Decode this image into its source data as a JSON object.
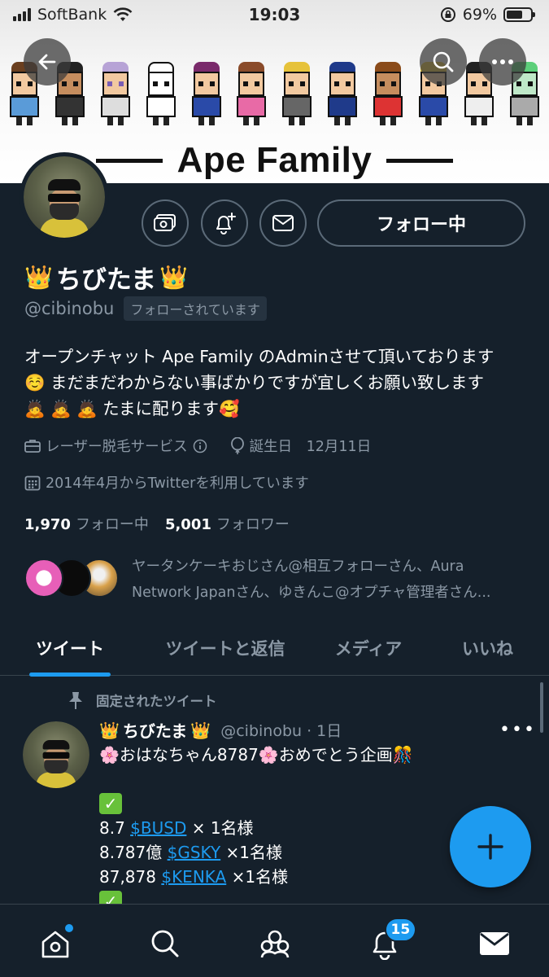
{
  "status_bar": {
    "carrier": "SoftBank",
    "time": "19:03",
    "battery": "69%",
    "battery_level": 0.69
  },
  "banner": {
    "title": "Ape Family"
  },
  "profile": {
    "crown_emoji": "👑",
    "display_name": "ちびたま",
    "handle": "@cibinobu",
    "follows_you": "フォローされています",
    "follow_button": "フォロー中",
    "bio_lines": [
      "オープンチャット Ape Family のAdminさせて頂いております",
      "☺️ まだまだわからない事ばかりですが宜しくお願い致します",
      "🙇 🙇 🙇 たまに配ります🥰"
    ],
    "category": "レーザー脱毛サービス",
    "birthday": "誕生日　12月11日",
    "joined": "2014年4月からTwitterを利用しています",
    "following_count": "1,970",
    "following_label": "フォロー中",
    "followers_count": "5,001",
    "followers_label": "フォロワー",
    "followed_by_lines": [
      "ヤータンケーキおじさん@相互フォローさん、Aura",
      "Network Japanさん、ゆきんこ@オプチャ管理者さん..."
    ]
  },
  "tabs": [
    "ツイート",
    "ツイートと返信",
    "メディア",
    "いいね"
  ],
  "pinned_tweet": {
    "pinned_label": "固定されたツイート",
    "author": "ちびたま",
    "handle_time": "@cibinobu · 1日",
    "line1": "🌸おはなちゃん8787🌸おめでとう企画🎊",
    "check": "✓",
    "giveaways": [
      {
        "prefix": "8.7 ",
        "tag": "$BUSD",
        "suffix": " × 1名様"
      },
      {
        "prefix": "8.787億 ",
        "tag": "$GSKY",
        "suffix": " ×1名様"
      },
      {
        "prefix": "87,878 ",
        "tag": "$KENKA",
        "suffix": " ×1名様"
      }
    ],
    "more": "•••"
  },
  "bottom_nav": {
    "notifications_badge": "15"
  },
  "colors": {
    "background": "#15202b",
    "accent": "#1d9bf0",
    "secondary_text": "#8b98a5",
    "border": "#38444d"
  }
}
